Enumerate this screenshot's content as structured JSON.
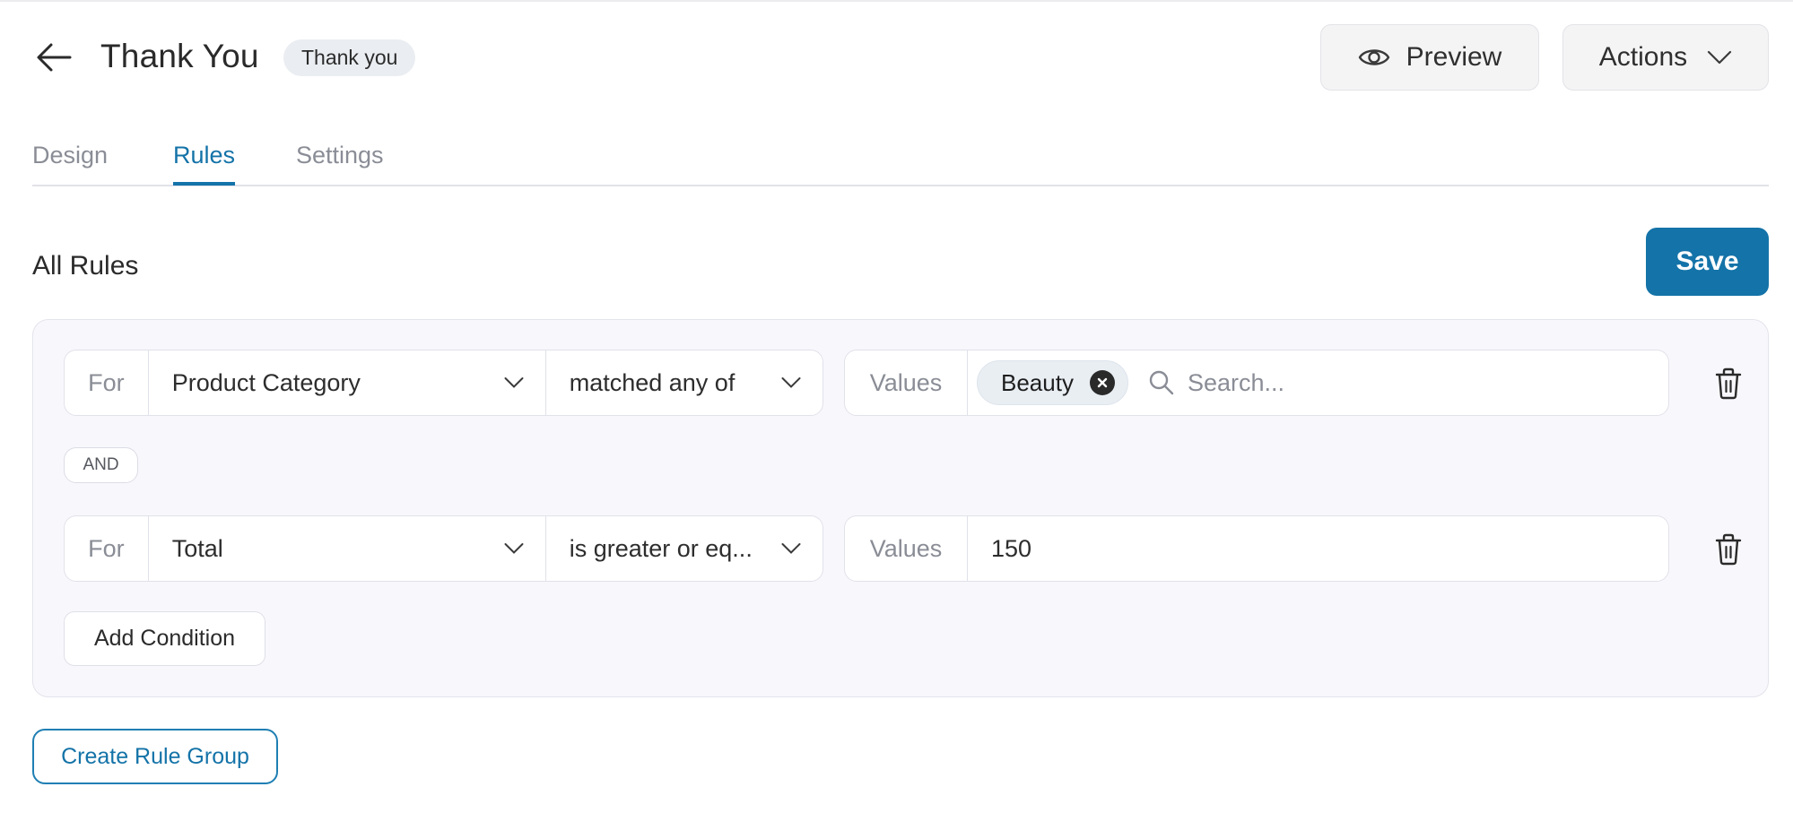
{
  "header": {
    "back_icon": "arrow-left-icon",
    "title": "Thank You",
    "badge": "Thank you",
    "preview_label": "Preview",
    "preview_icon": "eye-icon",
    "actions_label": "Actions",
    "actions_icon": "chevron-down-icon"
  },
  "tabs": [
    {
      "label": "Design",
      "active": false
    },
    {
      "label": "Rules",
      "active": true
    },
    {
      "label": "Settings",
      "active": false
    }
  ],
  "rules": {
    "section_title": "All Rules",
    "save_label": "Save",
    "conditions": [
      {
        "for_label": "For",
        "field": "Product Category",
        "operator": "matched any of",
        "values_label": "Values",
        "chips": [
          {
            "label": "Beauty",
            "remove_icon": "close-circle-icon"
          }
        ],
        "search_placeholder": "Search...",
        "search_icon": "search-icon",
        "delete_icon": "trash-icon"
      },
      {
        "for_label": "For",
        "field": "Total",
        "operator": "is greater or eq...",
        "values_label": "Values",
        "value": "150",
        "delete_icon": "trash-icon"
      }
    ],
    "connector": "AND",
    "add_condition_label": "Add Condition",
    "create_group_label": "Create Rule Group"
  },
  "colors": {
    "accent": "#1473a8",
    "panel_bg": "#f8f8fc",
    "muted_text": "#8a8d96"
  }
}
